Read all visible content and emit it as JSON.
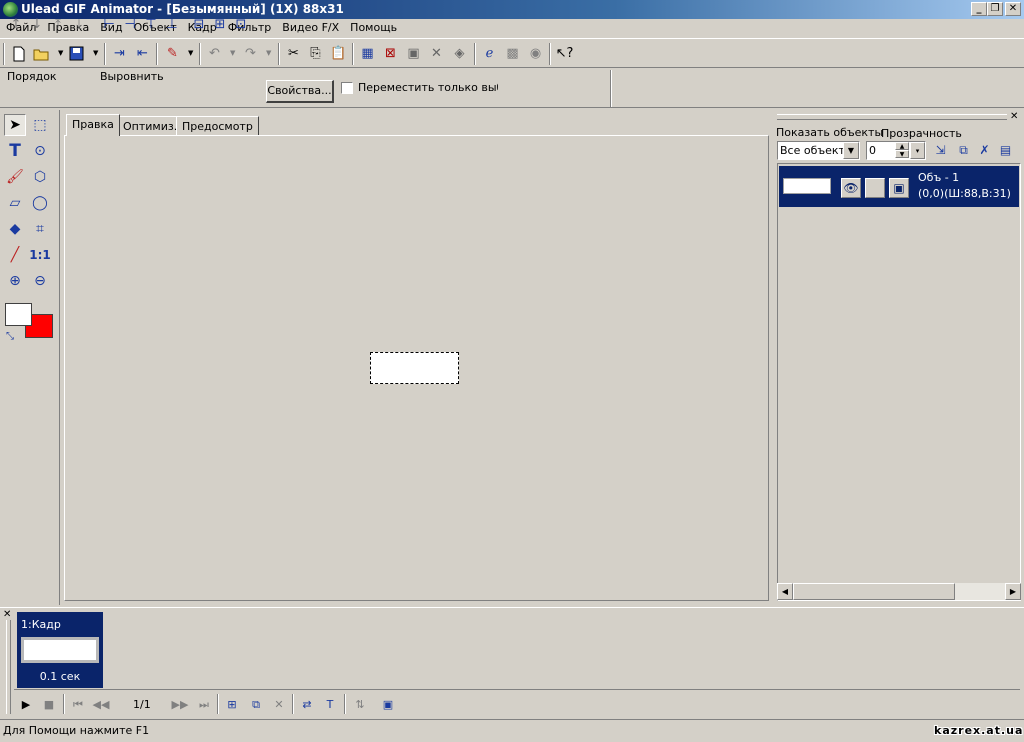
{
  "window": {
    "title": "Ulead GIF Animator - [Безымянный] (1X) 88x31",
    "minimize": "_",
    "restore": "❐",
    "close": "✕"
  },
  "menu": [
    "Файл",
    "Правка",
    "Вид",
    "Объект",
    "Кадр",
    "Фильтр",
    "Видео F/X",
    "Помощь"
  ],
  "toolbar2": {
    "order_label": "Порядок",
    "align_label": "Выровнить",
    "properties_button": "Свойства...",
    "move_selected_label": "Переместить только выбра",
    "move_selected_checked": false
  },
  "tools": {
    "zoom_label": "1:1",
    "foreground_color": "#ffffff",
    "background_color": "#ff0000"
  },
  "editor": {
    "tabs": [
      "Правка",
      "Оптимиз.",
      "Предосмотр"
    ],
    "active_tab": "Правка"
  },
  "objects": {
    "show_label": "Показать объекты",
    "transparency_label": "Прозрачность",
    "show_value": "Все объекты",
    "transparency_value": "0",
    "items": [
      {
        "name": "Объ - 1",
        "info": "(0,0)(Ш:88,В:31)"
      }
    ]
  },
  "frames": {
    "items": [
      {
        "label": "1:Кадр",
        "delay": "0.1 сек"
      }
    ],
    "counter": "1/1"
  },
  "status": {
    "text": "Для Помощи нажмите F1",
    "watermark": "kazrex.at.ua"
  },
  "colors": {
    "titlebar_start": "#0a246a",
    "titlebar_end": "#a6caf0",
    "selection": "#0a246a",
    "face": "#d4d0c8"
  }
}
